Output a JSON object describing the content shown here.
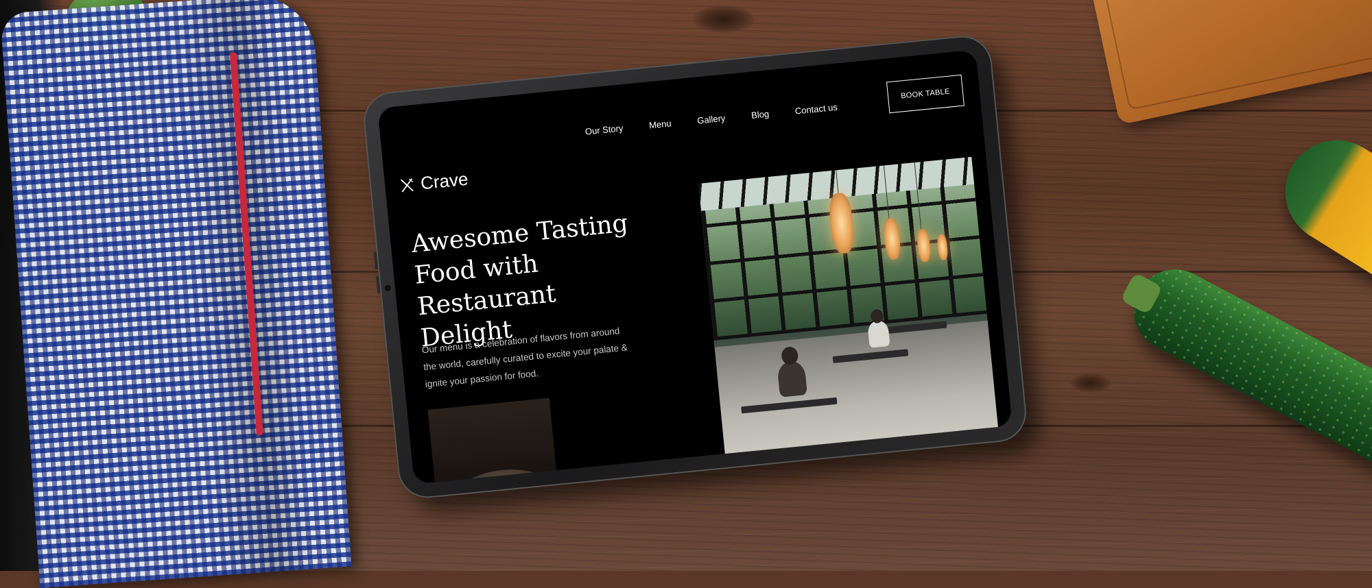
{
  "site": {
    "brand": "Crave",
    "nav": {
      "items": [
        "Our Story",
        "Menu",
        "Gallery",
        "Blog",
        "Contact us"
      ],
      "cta_label": "BOOK TABLE"
    },
    "hero": {
      "title_lines": [
        "Awesome Tasting",
        "Food with Restaurant",
        "Delight"
      ],
      "subtitle_lines": [
        "Our menu is a celebration of flavors from around",
        "the world, carefully curated to excite your palate &",
        "ignite your passion for food."
      ]
    }
  },
  "icons": {
    "logo": "fork-knife-icon"
  },
  "colors": {
    "screen_bg": "#000000",
    "text": "#ffffff",
    "subtitle_text": "#c8c8c8"
  }
}
